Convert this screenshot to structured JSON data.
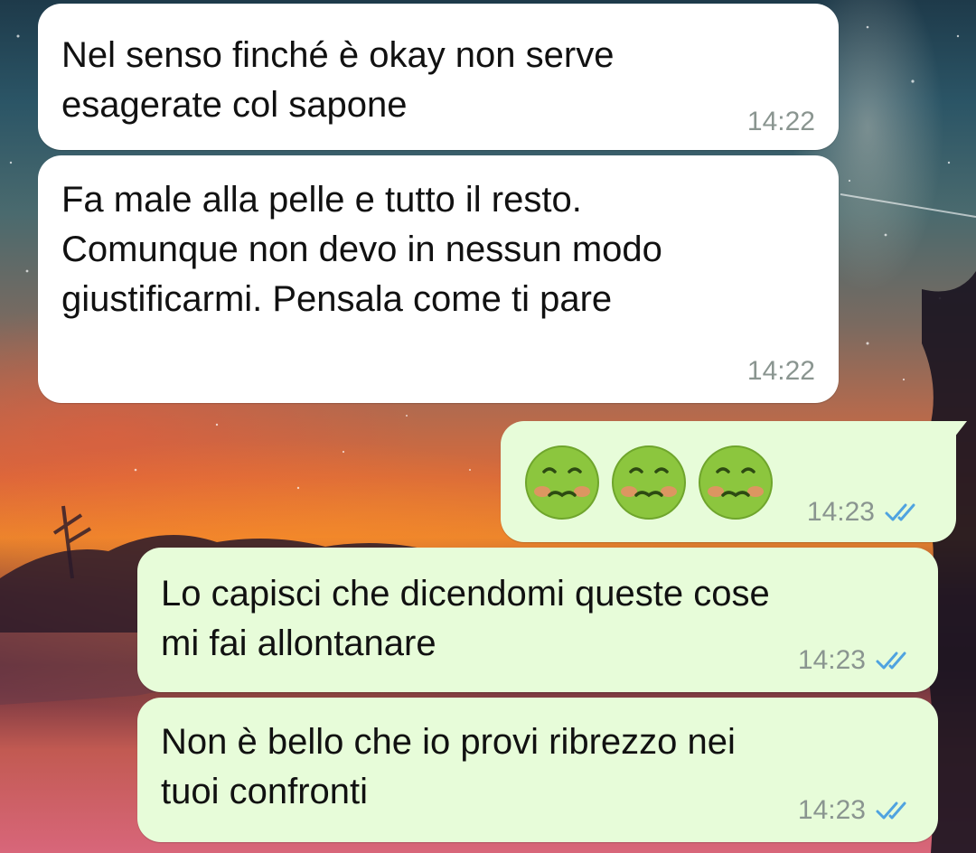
{
  "messages": [
    {
      "direction": "incoming",
      "text": "Nel senso finché è okay non serve\nesagerate col sapone",
      "time": "14:22"
    },
    {
      "direction": "incoming",
      "text": "Fa male alla pelle e tutto il resto.\nComunque non devo in nessun modo\ngiustificarmi. Pensala come ti pare",
      "time": "14:22"
    },
    {
      "direction": "outgoing",
      "emoji": [
        "nauseated-face",
        "nauseated-face",
        "nauseated-face"
      ],
      "time": "14:23",
      "status": "read"
    },
    {
      "direction": "outgoing",
      "text": "Lo capisci che dicendomi queste cose\nmi fai allontanare",
      "time": "14:23",
      "status": "read"
    },
    {
      "direction": "outgoing",
      "text": "Non è bello che io provi ribrezzo nei\ntuoi confronti",
      "time": "14:23",
      "status": "read"
    }
  ],
  "colors": {
    "incoming_bubble": "#ffffff",
    "outgoing_bubble": "#e7fcd9",
    "read_ticks": "#4fa3e0",
    "timestamp": "#8a9590"
  }
}
